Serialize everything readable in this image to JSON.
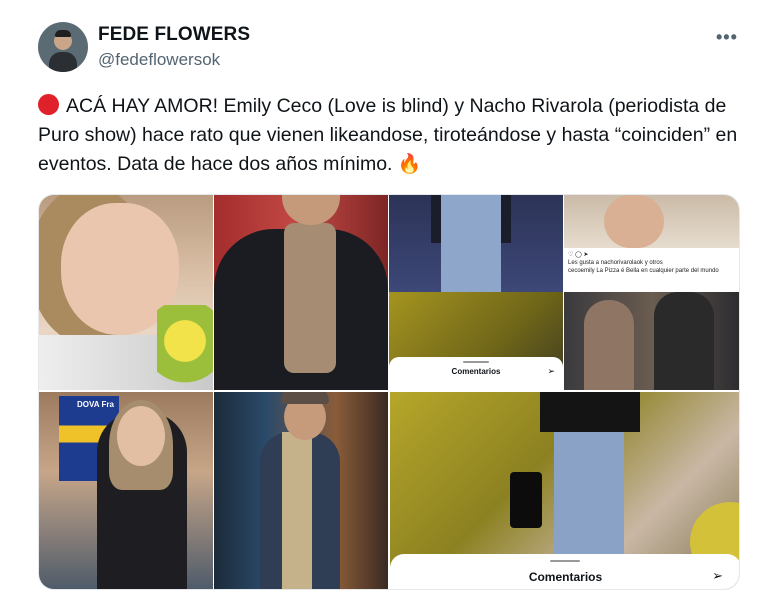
{
  "author": {
    "display_name": "FEDE FLOWERS",
    "handle": "@fedeflowersok"
  },
  "more_menu_glyph": "•••",
  "tweet": {
    "text": "ACÁ HAY AMOR! Emily Ceco (Love is blind) y  Nacho Rivarola (periodista de Puro show)  hace rato que vienen likeandose, tiroteándose y hasta “coinciden” en eventos. Data de hace dos años mínimo.",
    "emoji_fire": "🔥",
    "red_dot_color": "#e0202b"
  },
  "media": {
    "comments_label_small": "Comentarios",
    "comments_label_big": "Comentarios",
    "jersey_text": "DOVA Fra",
    "insta_likes": "Les gusta a nachorivarolaok y otros",
    "insta_caption": "cecoemily La Pizza é Bella en cualquier parte del mundo"
  },
  "icons": {
    "more": "more-horizontal-icon",
    "send": "send-icon",
    "fire": "fire-emoji-icon"
  }
}
